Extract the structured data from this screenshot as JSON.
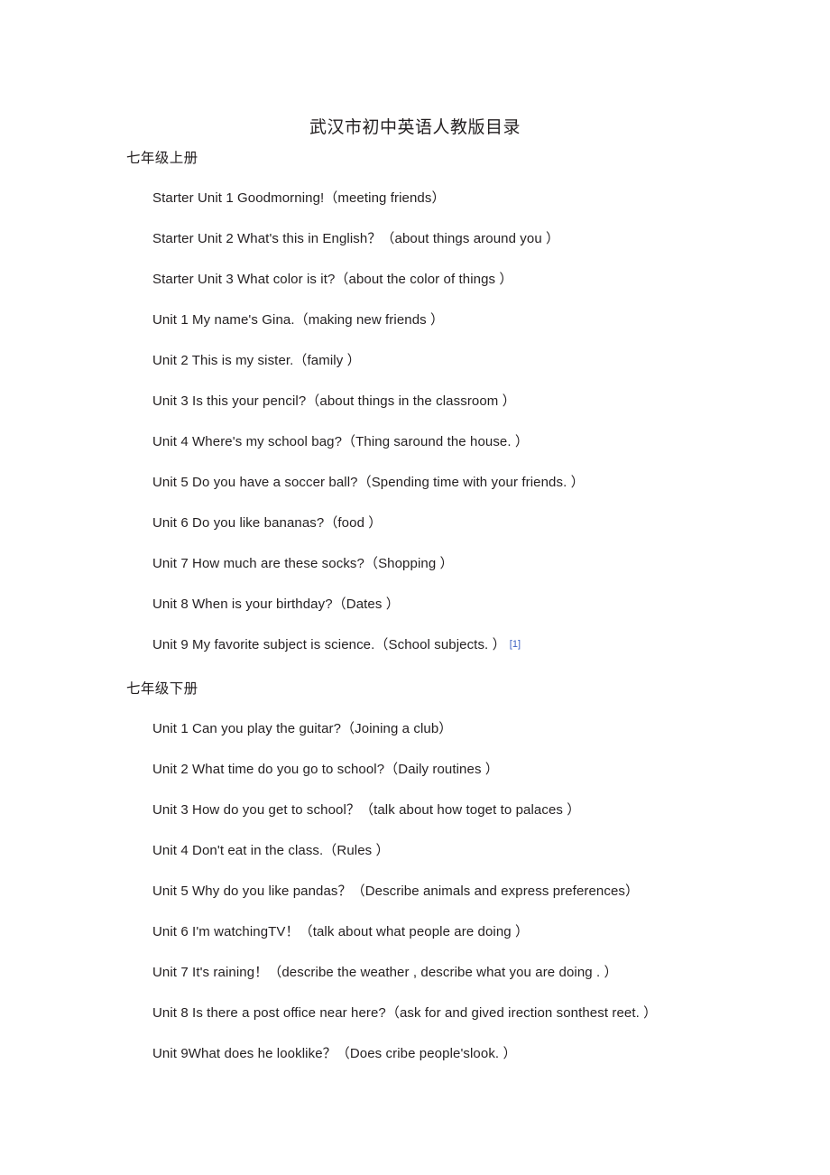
{
  "document": {
    "title": "武汉市初中英语人教版目录",
    "footnote_marker": "[1]",
    "link_color": "#3b5fc0",
    "text_color": "#231f20",
    "background_color": "#ffffff"
  },
  "sections": [
    {
      "heading": "七年级上册",
      "units": [
        {
          "text": "Starter Unit 1 Goodmorning!（meeting friends）"
        },
        {
          "text": "Starter Unit 2 What's this in English？（about things around you ）"
        },
        {
          "text": "Starter Unit 3 What color is it?（about the color of things ）"
        },
        {
          "text": "Unit 1 My name's Gina.（making new friends ）"
        },
        {
          "text": "Unit 2 This is my sister.（family ）"
        },
        {
          "text": "Unit 3 Is this your pencil?（about things in the classroom ）"
        },
        {
          "text": "Unit 4 Where's my school bag?（Thing saround the house. ）"
        },
        {
          "text": "Unit 5 Do you have a soccer ball?（Spending time with your friends. ）"
        },
        {
          "text": "Unit 6 Do you like bananas?（food ）"
        },
        {
          "text": "Unit 7 How much are these socks?（Shopping ）"
        },
        {
          "text": "Unit 8 When is your birthday?（Dates ）"
        },
        {
          "text": "Unit 9 My favorite subject is science.（School subjects. ）",
          "footnote": "[1]"
        }
      ]
    },
    {
      "heading": "七年级下册",
      "units": [
        {
          "text": "Unit 1 Can you play the guitar?（Joining a club）"
        },
        {
          "text": "Unit 2 What time do you go to school?（Daily routines ）"
        },
        {
          "text": "Unit 3 How do you get to school？（talk about how toget to palaces ）"
        },
        {
          "text": "Unit 4 Don't eat in the class.（Rules ）"
        },
        {
          "text": "Unit 5 Why do you like pandas？（Describe animals and express preferences）"
        },
        {
          "text": "Unit 6 I'm watchingTV！（talk about what people are doing ）"
        },
        {
          "text": "Unit 7 It's raining！（describe the weather , describe what you are doing . ）"
        },
        {
          "text": "Unit 8 Is there a post office near here?（ask for and gived irection sonthest reet. ）"
        },
        {
          "text": "Unit 9What does he looklike？（Does cribe people'slook. ）"
        }
      ]
    }
  ]
}
